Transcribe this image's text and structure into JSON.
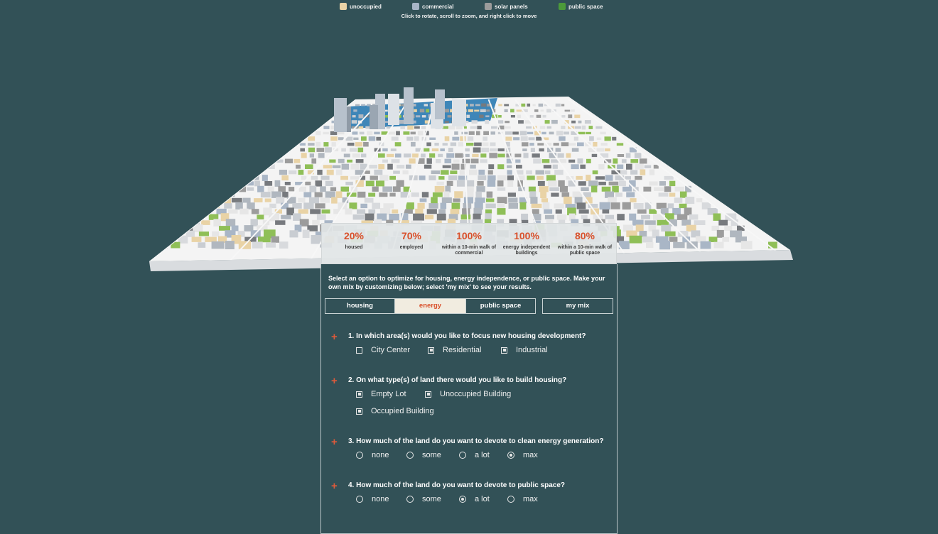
{
  "legend": [
    {
      "label": "unoccupied",
      "color": "#e9d3a6"
    },
    {
      "label": "commercial",
      "color": "#a7b4c6"
    },
    {
      "label": "solar panels",
      "color": "#9b9b9b"
    },
    {
      "label": "public space",
      "color": "#4c9a3a"
    }
  ],
  "hint": "Click to rotate, scroll to zoom, and right click to move",
  "stats": [
    {
      "value": "20%",
      "label": "housed"
    },
    {
      "value": "70%",
      "label": "employed"
    },
    {
      "value": "100%",
      "label": "within a 10-min walk of commercial"
    },
    {
      "value": "100%",
      "label": "energy independent buildings"
    },
    {
      "value": "80%",
      "label": "within a 10-min walk of public space"
    }
  ],
  "intro": "Select an option to optimize for housing, energy independence, or public space. Make your own mix by customizing below; select 'my mix' to see your results.",
  "tabs": [
    {
      "label": "housing",
      "active": false
    },
    {
      "label": "energy",
      "active": true
    },
    {
      "label": "public space",
      "active": false
    },
    {
      "label": "my mix",
      "active": false
    }
  ],
  "questions": [
    {
      "text": "1. In which area(s) would you like to focus new housing development?",
      "type": "checkbox",
      "options": [
        {
          "label": "City Center",
          "checked": false
        },
        {
          "label": "Residential",
          "checked": true
        },
        {
          "label": "Industrial",
          "checked": true
        }
      ]
    },
    {
      "text": "2. On what type(s) of land there would you like to build housing?",
      "type": "checkbox",
      "options": [
        {
          "label": "Empty Lot",
          "checked": true
        },
        {
          "label": "Unoccupied Building",
          "checked": true
        },
        {
          "label": "Occupied Building",
          "checked": true
        }
      ]
    },
    {
      "text": "3. How much of the land do you want to devote to clean energy generation?",
      "type": "radio",
      "options": [
        {
          "label": "none",
          "checked": false
        },
        {
          "label": "some",
          "checked": false
        },
        {
          "label": "a lot",
          "checked": false
        },
        {
          "label": "max",
          "checked": true
        }
      ]
    },
    {
      "text": "4. How much of the land do you want to devote to public space?",
      "type": "radio",
      "options": [
        {
          "label": "none",
          "checked": false
        },
        {
          "label": "some",
          "checked": false
        },
        {
          "label": "a lot",
          "checked": true
        },
        {
          "label": "max",
          "checked": false
        }
      ]
    }
  ]
}
